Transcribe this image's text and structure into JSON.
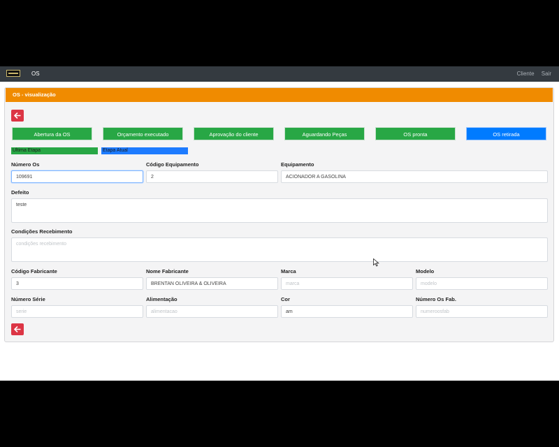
{
  "navbar": {
    "brand": "OS",
    "links": [
      "Cliente",
      "Sair"
    ]
  },
  "card": {
    "title": "OS - visualização"
  },
  "stages": [
    {
      "label": "Abertura da OS",
      "status": "done"
    },
    {
      "label": "Orçamento executado",
      "status": "done"
    },
    {
      "label": "Aprovação do cliente",
      "status": "done"
    },
    {
      "label": "Aguardando Peças",
      "status": "done"
    },
    {
      "label": "OS pronta",
      "status": "done"
    },
    {
      "label": "OS retirada",
      "status": "current"
    }
  ],
  "legend": {
    "last": "Ultima Etapa",
    "current": "Etapa Atual"
  },
  "colors": {
    "navbar": "#343a40",
    "header": "#f08b00",
    "done": "#28a745",
    "current": "#007bff",
    "back": "#dc3545"
  },
  "fields": {
    "numero_os": {
      "label": "Número Os",
      "value": "109691"
    },
    "codigo_equipamento": {
      "label": "Código Equipamento",
      "value": "2"
    },
    "equipamento": {
      "label": "Equipamento",
      "value": "ACIONADOR A GASOLINA"
    },
    "defeito": {
      "label": "Defeito",
      "value": "teste"
    },
    "condicoes": {
      "label": "Condições Recebimento",
      "placeholder": "condições recebimento"
    },
    "codigo_fabricante": {
      "label": "Código Fabricante",
      "value": "3"
    },
    "nome_fabricante": {
      "label": "Nome Fabricante",
      "value": "BRENTAN OLIVEIRA & OLIVEIRA"
    },
    "marca": {
      "label": "Marca",
      "placeholder": "marca"
    },
    "modelo": {
      "label": "Modelo",
      "placeholder": "modelo"
    },
    "numero_serie": {
      "label": "Número Série",
      "placeholder": "serie"
    },
    "alimentacao": {
      "label": "Alimentação",
      "placeholder": "alimentacao"
    },
    "cor": {
      "label": "Cor",
      "value": "am"
    },
    "numero_os_fab": {
      "label": "Número Os Fab.",
      "placeholder": "numeroosfab"
    }
  },
  "icons": {
    "back": "arrow-left-icon",
    "logo": "company-logo"
  }
}
